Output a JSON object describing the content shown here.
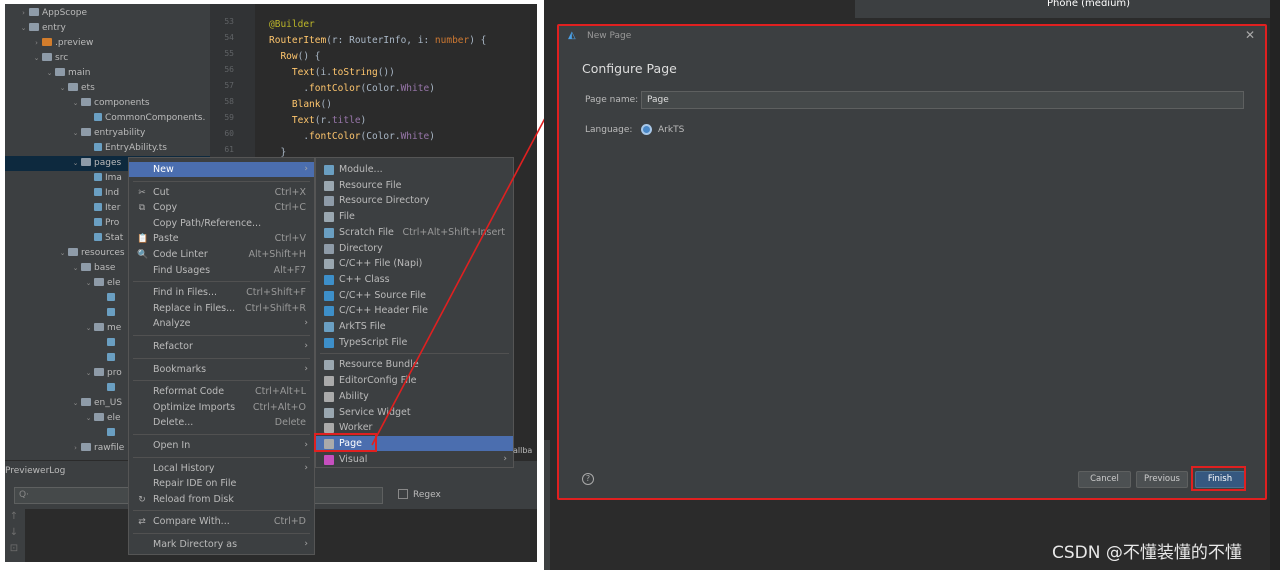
{
  "project_tree": [
    {
      "label": "AppScope",
      "indent": 0,
      "arrow": "›",
      "kind": "folder"
    },
    {
      "label": "entry",
      "indent": 0,
      "arrow": "⌄",
      "kind": "folder"
    },
    {
      "label": ".preview",
      "indent": 1,
      "arrow": "›",
      "kind": "folder-orange"
    },
    {
      "label": "src",
      "indent": 1,
      "arrow": "⌄",
      "kind": "folder"
    },
    {
      "label": "main",
      "indent": 2,
      "arrow": "⌄",
      "kind": "folder"
    },
    {
      "label": "ets",
      "indent": 3,
      "arrow": "⌄",
      "kind": "folder"
    },
    {
      "label": "components",
      "indent": 4,
      "arrow": "⌄",
      "kind": "folder"
    },
    {
      "label": "CommonComponents.",
      "indent": 5,
      "arrow": "",
      "kind": "file"
    },
    {
      "label": "entryability",
      "indent": 4,
      "arrow": "⌄",
      "kind": "folder"
    },
    {
      "label": "EntryAbility.ts",
      "indent": 5,
      "arrow": "",
      "kind": "file"
    },
    {
      "label": "pages",
      "indent": 4,
      "arrow": "⌄",
      "kind": "folder",
      "selected": true
    },
    {
      "label": "Ima",
      "indent": 5,
      "arrow": "",
      "kind": "file"
    },
    {
      "label": "Ind",
      "indent": 5,
      "arrow": "",
      "kind": "file"
    },
    {
      "label": "Iter",
      "indent": 5,
      "arrow": "",
      "kind": "file"
    },
    {
      "label": "Pro",
      "indent": 5,
      "arrow": "",
      "kind": "file"
    },
    {
      "label": "Stat",
      "indent": 5,
      "arrow": "",
      "kind": "file"
    },
    {
      "label": "resources",
      "indent": 3,
      "arrow": "⌄",
      "kind": "folder"
    },
    {
      "label": "base",
      "indent": 4,
      "arrow": "⌄",
      "kind": "folder"
    },
    {
      "label": "ele",
      "indent": 5,
      "arrow": "⌄",
      "kind": "folder"
    },
    {
      "label": "",
      "indent": 6,
      "arrow": "",
      "kind": "file"
    },
    {
      "label": "",
      "indent": 6,
      "arrow": "",
      "kind": "file"
    },
    {
      "label": "me",
      "indent": 5,
      "arrow": "⌄",
      "kind": "folder"
    },
    {
      "label": "",
      "indent": 6,
      "arrow": "",
      "kind": "file"
    },
    {
      "label": "",
      "indent": 6,
      "arrow": "",
      "kind": "file"
    },
    {
      "label": "pro",
      "indent": 5,
      "arrow": "⌄",
      "kind": "folder"
    },
    {
      "label": "",
      "indent": 6,
      "arrow": "",
      "kind": "file"
    },
    {
      "label": "en_US",
      "indent": 4,
      "arrow": "⌄",
      "kind": "folder"
    },
    {
      "label": "ele",
      "indent": 5,
      "arrow": "⌄",
      "kind": "folder"
    },
    {
      "label": "",
      "indent": 6,
      "arrow": "",
      "kind": "file"
    },
    {
      "label": "rawfile",
      "indent": 4,
      "arrow": "›",
      "kind": "folder"
    }
  ],
  "line_numbers": [
    "53",
    "54",
    "55",
    "56",
    "57",
    "58",
    "59",
    "60",
    "61"
  ],
  "code_lines": [
    [
      {
        "t": "@Builder",
        "c": "dec"
      }
    ],
    [
      {
        "t": "RouterItem",
        "c": "fn"
      },
      {
        "t": "(r: ",
        "c": "ty"
      },
      {
        "t": "RouterInfo",
        "c": "ty"
      },
      {
        "t": ", i: ",
        "c": "ty"
      },
      {
        "t": "number",
        "c": "kw"
      },
      {
        "t": ") {",
        "c": "ty"
      }
    ],
    [
      {
        "t": "  Row",
        "c": "fn"
      },
      {
        "t": "() {",
        "c": "ty"
      }
    ],
    [
      {
        "t": "    Text",
        "c": "fn"
      },
      {
        "t": "(i.",
        "c": "ty"
      },
      {
        "t": "toString",
        "c": "fn"
      },
      {
        "t": "())",
        "c": "ty"
      }
    ],
    [
      {
        "t": "      .",
        "c": "ty"
      },
      {
        "t": "fontColor",
        "c": "fn"
      },
      {
        "t": "(Color.",
        "c": "ty"
      },
      {
        "t": "White",
        "c": "pr"
      },
      {
        "t": ")",
        "c": "ty"
      }
    ],
    [
      {
        "t": "    Blank",
        "c": "fn"
      },
      {
        "t": "()",
        "c": "ty"
      }
    ],
    [
      {
        "t": "    Text",
        "c": "fn"
      },
      {
        "t": "(r.",
        "c": "ty"
      },
      {
        "t": "title",
        "c": "pr"
      },
      {
        "t": ")",
        "c": "ty"
      }
    ],
    [
      {
        "t": "      .",
        "c": "ty"
      },
      {
        "t": "fontColor",
        "c": "fn"
      },
      {
        "t": "(Color.",
        "c": "ty"
      },
      {
        "t": "White",
        "c": "pr"
      },
      {
        "t": ")",
        "c": "ty"
      }
    ],
    [
      {
        "t": "  }",
        "c": "ty"
      }
    ]
  ],
  "previewer_log": {
    "title": "PreviewerLog",
    "search_placeholder": "Q·",
    "regex_label": "Regex",
    "side_icons": [
      "↑",
      "↓",
      "⊡"
    ]
  },
  "context_menu": [
    {
      "label": "New",
      "shortcut": "",
      "submenu": true,
      "icon": "",
      "highlighted": true
    },
    {
      "sep": true
    },
    {
      "label": "Cut",
      "shortcut": "Ctrl+X",
      "icon": "✂"
    },
    {
      "label": "Copy",
      "shortcut": "Ctrl+C",
      "icon": "⧉"
    },
    {
      "label": "Copy Path/Reference...",
      "shortcut": "",
      "icon": ""
    },
    {
      "label": "Paste",
      "shortcut": "Ctrl+V",
      "icon": "📋"
    },
    {
      "label": "Code Linter",
      "shortcut": "Alt+Shift+H",
      "icon": "🔍"
    },
    {
      "label": "Find Usages",
      "shortcut": "Alt+F7",
      "icon": ""
    },
    {
      "sep": true
    },
    {
      "label": "Find in Files...",
      "shortcut": "Ctrl+Shift+F",
      "icon": ""
    },
    {
      "label": "Replace in Files...",
      "shortcut": "Ctrl+Shift+R",
      "icon": ""
    },
    {
      "label": "Analyze",
      "shortcut": "",
      "submenu": true,
      "icon": ""
    },
    {
      "sep": true
    },
    {
      "label": "Refactor",
      "shortcut": "",
      "submenu": true,
      "icon": ""
    },
    {
      "sep": true
    },
    {
      "label": "Bookmarks",
      "shortcut": "",
      "submenu": true,
      "icon": ""
    },
    {
      "sep": true
    },
    {
      "label": "Reformat Code",
      "shortcut": "Ctrl+Alt+L",
      "icon": ""
    },
    {
      "label": "Optimize Imports",
      "shortcut": "Ctrl+Alt+O",
      "icon": ""
    },
    {
      "label": "Delete...",
      "shortcut": "Delete",
      "icon": ""
    },
    {
      "sep": true
    },
    {
      "label": "Open In",
      "shortcut": "",
      "submenu": true,
      "icon": ""
    },
    {
      "sep": true
    },
    {
      "label": "Local History",
      "shortcut": "",
      "submenu": true,
      "icon": ""
    },
    {
      "label": "Repair IDE on File",
      "shortcut": "",
      "icon": ""
    },
    {
      "label": "Reload from Disk",
      "shortcut": "",
      "icon": "↻"
    },
    {
      "sep": true
    },
    {
      "label": "Compare With...",
      "shortcut": "Ctrl+D",
      "icon": "⇄"
    },
    {
      "sep": true
    },
    {
      "label": "Mark Directory as",
      "shortcut": "",
      "submenu": true,
      "icon": ""
    }
  ],
  "new_submenu": [
    {
      "label": "Module...",
      "icon": "module-icon",
      "color": "#6a9fc2"
    },
    {
      "label": "Resource File",
      "icon": "resource-file-icon",
      "color": "#9aa7b0"
    },
    {
      "label": "Resource Directory",
      "icon": "folder-icon",
      "color": "#8e9ba8"
    },
    {
      "label": "File",
      "icon": "file-icon",
      "color": "#9aa7b0"
    },
    {
      "label": "Scratch File",
      "shortcut": "Ctrl+Alt+Shift+Insert",
      "icon": "scratch-file-icon",
      "color": "#6a9fc2"
    },
    {
      "label": "Directory",
      "icon": "folder-icon",
      "color": "#8e9ba8"
    },
    {
      "label": "C/C++ File (Napi)",
      "icon": "cpp-file-icon",
      "color": "#9aa7b0"
    },
    {
      "label": "C++ Class",
      "icon": "cpp-class-icon",
      "color": "#3d8fc9"
    },
    {
      "label": "C/C++ Source File",
      "icon": "cpp-source-icon",
      "color": "#3d8fc9"
    },
    {
      "label": "C/C++ Header File",
      "icon": "cpp-header-icon",
      "color": "#3d8fc9"
    },
    {
      "label": "ArkTS File",
      "icon": "arkts-file-icon",
      "color": "#6a9fc2"
    },
    {
      "label": "TypeScript File",
      "icon": "ts-file-icon",
      "color": "#3d8fc9"
    },
    {
      "sep": true
    },
    {
      "label": "Resource Bundle",
      "icon": "resource-bundle-icon",
      "color": "#9aa7b0"
    },
    {
      "label": "EditorConfig File",
      "icon": "gear-icon",
      "color": "#aaaaaa"
    },
    {
      "label": "Ability",
      "icon": "ability-icon",
      "color": "#aaaaaa"
    },
    {
      "label": "Service Widget",
      "icon": "widget-icon",
      "color": "#9aa7b0"
    },
    {
      "label": "Worker",
      "icon": "worker-icon",
      "color": "#aaaaaa"
    },
    {
      "label": "Page",
      "icon": "page-icon",
      "color": "#aaaaaa",
      "highlighted": true
    },
    {
      "label": "Visual",
      "icon": "visual-icon",
      "color": "#c64fbf",
      "submenu": true
    }
  ],
  "dialog": {
    "title": "New Page",
    "heading": "Configure Page",
    "page_name_label": "Page name:",
    "page_name_value": "Page",
    "language_label": "Language:",
    "language_value": "ArkTS",
    "cancel": "Cancel",
    "previous": "Previous",
    "finish": "Finish",
    "help": "?"
  },
  "phone_label": "Phone (medium)",
  "partial_text": "allba",
  "watermark": "CSDN @不懂装懂的不懂",
  "colors": {
    "highlight": "#4b6eaf",
    "annotation_red": "#e02020",
    "finish_button": "#365880"
  }
}
